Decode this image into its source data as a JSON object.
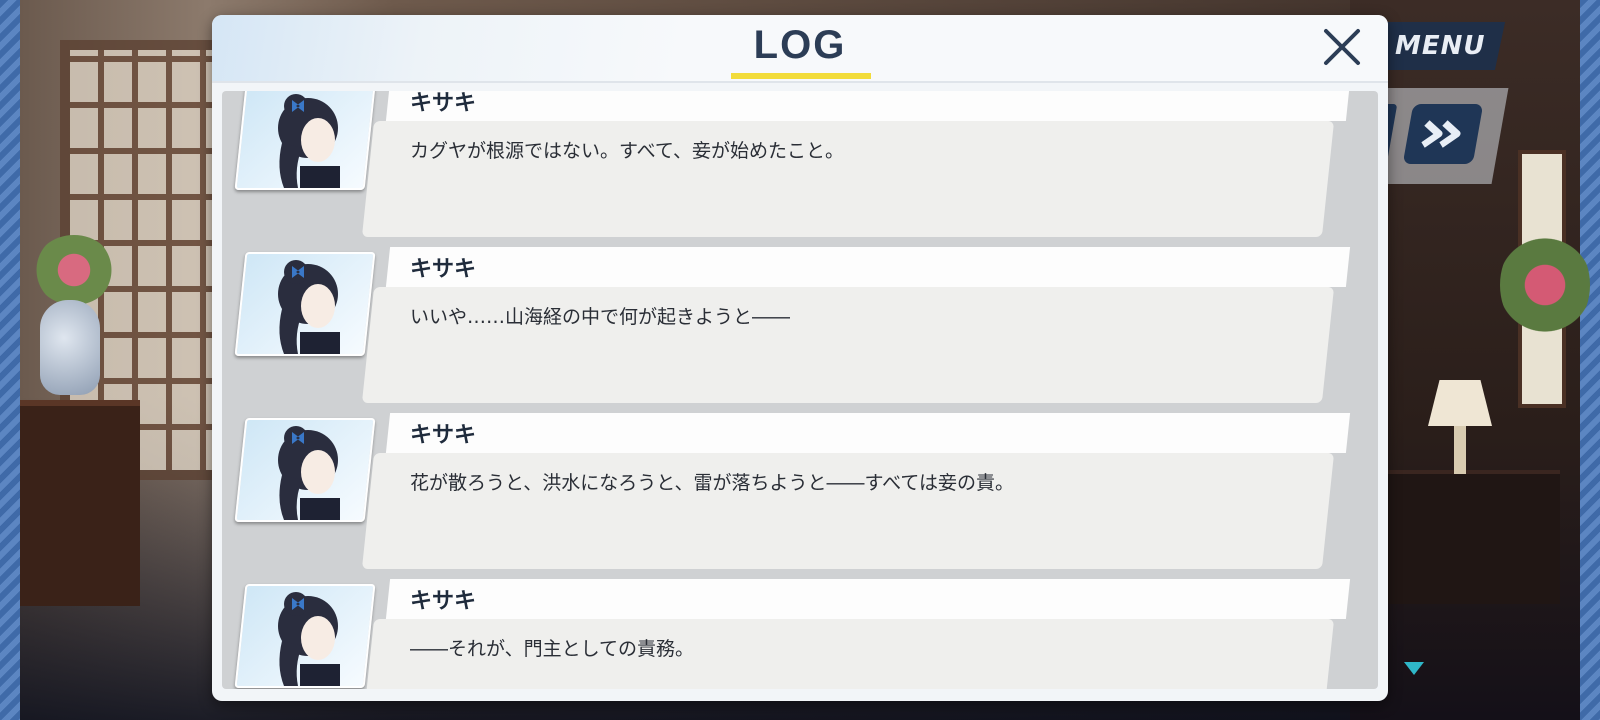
{
  "menu": {
    "label": "MENU"
  },
  "log": {
    "title": "LOG",
    "entries": [
      {
        "speaker": "キサキ",
        "text": "カグヤが根源ではない。すべて、妾が始めたこと。"
      },
      {
        "speaker": "キサキ",
        "text": "いいや……山海経の中で何が起きようと――"
      },
      {
        "speaker": "キサキ",
        "text": "花が散ろうと、洪水になろうと、雷が落ちようと――すべては妾の責。"
      },
      {
        "speaker": "キサキ",
        "text": "――それが、門主としての責務。"
      }
    ]
  },
  "icons": {
    "close": "close-icon",
    "fast_forward": "fast-forward-icon",
    "next": "next-indicator-icon"
  },
  "colors": {
    "title_text": "#2c3d56",
    "title_underline": "#f2dc3a",
    "menu_button": "#1f2f48",
    "next_indicator": "#2fb7c8"
  }
}
